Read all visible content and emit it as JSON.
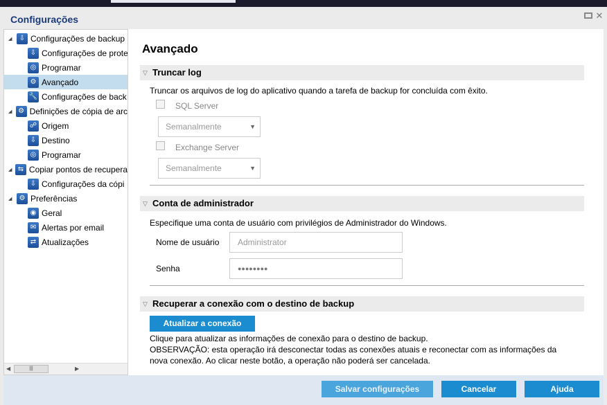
{
  "window": {
    "title": "Configurações",
    "restore_icon": "restore-icon",
    "close_icon": "close-icon"
  },
  "tree": [
    {
      "label": "Configurações de backup",
      "level": 0
    },
    {
      "label": "Configurações de prote",
      "level": 1
    },
    {
      "label": "Programar",
      "level": 1
    },
    {
      "label": "Avançado",
      "level": 1,
      "selected": true
    },
    {
      "label": "Configurações de back",
      "level": 1
    },
    {
      "label": "Definições de cópia de arc",
      "level": 0
    },
    {
      "label": "Origem",
      "level": 1
    },
    {
      "label": "Destino",
      "level": 1
    },
    {
      "label": "Programar",
      "level": 1
    },
    {
      "label": "Copiar pontos de recupera",
      "level": 0
    },
    {
      "label": "Configurações da cópi",
      "level": 1
    },
    {
      "label": "Preferências",
      "level": 0
    },
    {
      "label": "Geral",
      "level": 1
    },
    {
      "label": "Alertas por email",
      "level": 1
    },
    {
      "label": "Atualizações",
      "level": 1
    }
  ],
  "main": {
    "heading": "Avançado",
    "truncate": {
      "title": "Truncar log",
      "desc": "Truncar os arquivos de log do aplicativo quando a tarefa de backup for concluída com êxito.",
      "sql_label": "SQL Server",
      "sql_freq": "Semanalmente",
      "exch_label": "Exchange Server",
      "exch_freq": "Semanalmente"
    },
    "admin": {
      "title": "Conta de administrador",
      "desc": "Especifique uma conta de usuário com privilégios de Administrador do Windows.",
      "user_label": "Nome de usuário",
      "user_value": "Administrator",
      "pass_label": "Senha",
      "pass_value": "●●●●●●●●"
    },
    "reconnect": {
      "title": "Recuperar a conexão com o destino de backup",
      "button": "Atualizar a conexão",
      "line1": "Clique para atualizar as informações de conexão para o destino de backup.",
      "line2": "OBSERVAÇÃO: esta operação irá desconectar todas as conexões atuais e reconectar com as informações da",
      "line3": "nova conexão. Ao clicar neste botão, a operação não poderá ser cancelada."
    }
  },
  "footer": {
    "save": "Salvar configurações",
    "cancel": "Cancelar",
    "help": "Ajuda"
  },
  "colors": {
    "accent": "#1a8ccf",
    "selection": "#c3dcee",
    "footer": "#dfe7f3"
  }
}
